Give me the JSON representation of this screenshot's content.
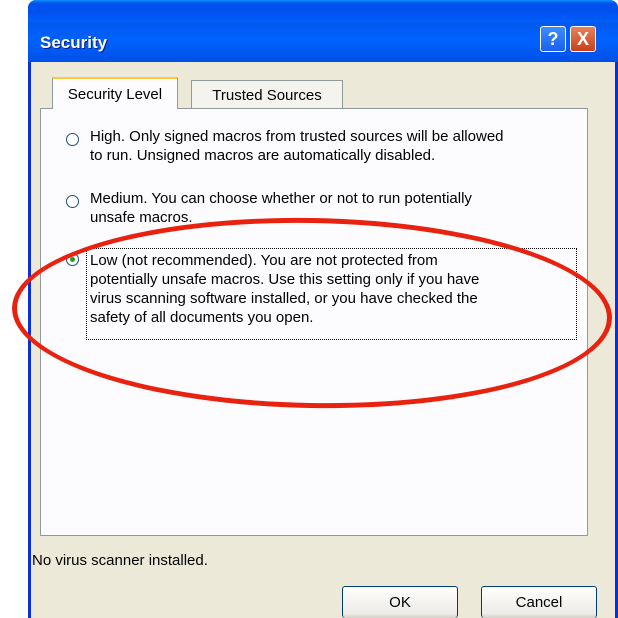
{
  "window": {
    "title": "Security",
    "help_label": "?",
    "close_label": "X"
  },
  "tabs": [
    {
      "label": "Security Level",
      "selected": true
    },
    {
      "label": "Trusted Sources",
      "selected": false
    }
  ],
  "options": [
    {
      "line1": "High. Only signed macros from trusted sources will be allowed",
      "line2": "to run. Unsigned macros are automatically disabled.",
      "checked": false
    },
    {
      "line1": "Medium. You can choose whether or not to run potentially",
      "line2": "unsafe macros.",
      "checked": false
    },
    {
      "line1": "Low (not recommended). You are not protected from",
      "line2": "potentially unsafe macros. Use this setting only if you have",
      "line3": "virus scanning software installed, or you have checked the",
      "line4": "safety of all documents you open.",
      "checked": true
    }
  ],
  "status": "No virus scanner installed.",
  "buttons": {
    "ok": "OK",
    "cancel": "Cancel"
  },
  "colors": {
    "title_bar": "#0058ee",
    "dialog_face": "#ece9d8",
    "annotation": "#e8220e",
    "radio_dot": "#21a121"
  }
}
